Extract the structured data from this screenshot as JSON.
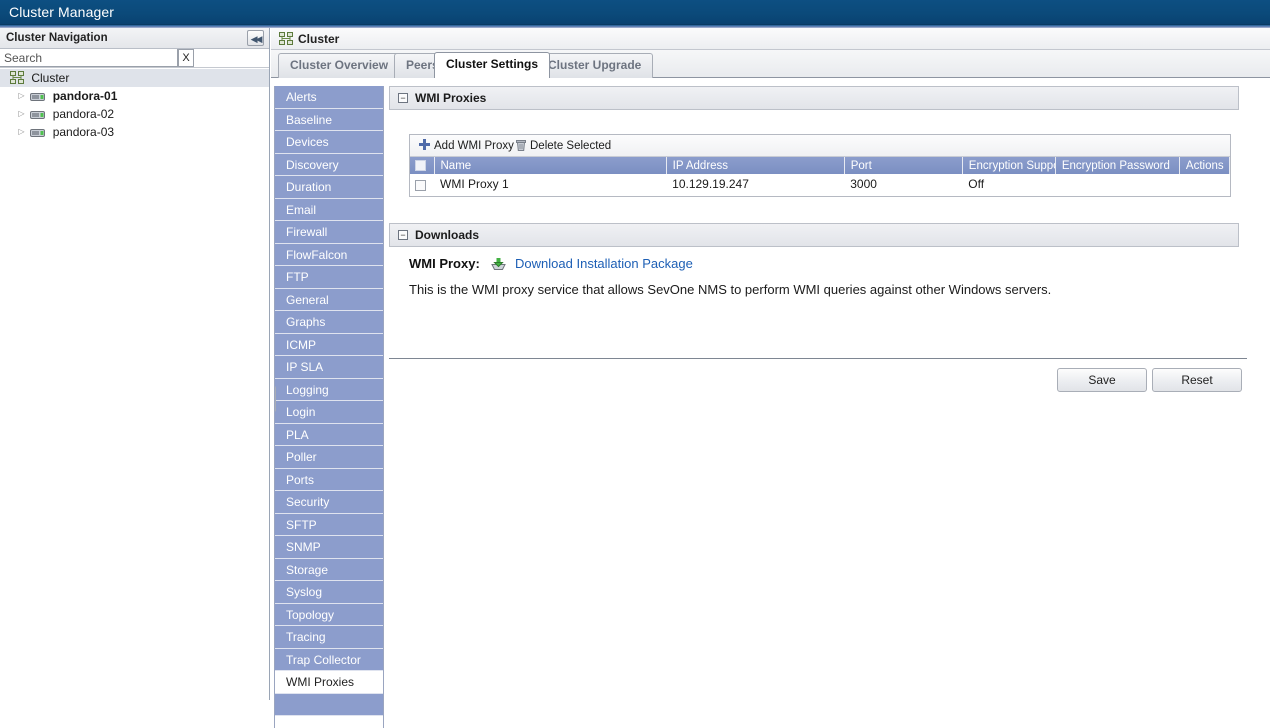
{
  "window": {
    "title": "Cluster Manager"
  },
  "sidebar": {
    "header": "Cluster Navigation",
    "collapse_glyph": "◀◀",
    "search": {
      "placeholder": "Search",
      "value": "",
      "clear_label": "X"
    },
    "tree": [
      {
        "label": "Cluster",
        "icon": "cluster-icon",
        "selected": true,
        "bold": false
      },
      {
        "label": "pandora-01",
        "icon": "server-icon",
        "selected": false,
        "bold": true
      },
      {
        "label": "pandora-02",
        "icon": "server-icon",
        "selected": false,
        "bold": false
      },
      {
        "label": "pandora-03",
        "icon": "server-icon",
        "selected": false,
        "bold": false
      }
    ]
  },
  "breadcrumb": {
    "label": "Cluster",
    "icon": "cluster-icon"
  },
  "tabs": [
    {
      "label": "Cluster Overview",
      "active": false
    },
    {
      "label": "Peers",
      "active": false
    },
    {
      "label": "Cluster Settings",
      "active": true
    },
    {
      "label": "Cluster Upgrade",
      "active": false
    }
  ],
  "settings_menu": {
    "active": "WMI Proxies",
    "items": [
      "Alerts",
      "Baseline",
      "Devices",
      "Discovery",
      "Duration",
      "Email",
      "Firewall",
      "FlowFalcon",
      "FTP",
      "General",
      "Graphs",
      "ICMP",
      "IP SLA",
      "Logging",
      "Login",
      "PLA",
      "Poller",
      "Ports",
      "Security",
      "SFTP",
      "SNMP",
      "Storage",
      "Syslog",
      "Topology",
      "Tracing",
      "Trap Collector",
      "WMI Proxies"
    ]
  },
  "wmi_panel": {
    "title": "WMI Proxies",
    "collapse_glyph": "−",
    "toolbar": {
      "add_label": "Add WMI Proxy",
      "delete_label": "Delete Selected",
      "add_icon": "plus-icon",
      "delete_icon": "trash-icon"
    },
    "table": {
      "columns": [
        "Name",
        "IP Address",
        "Port",
        "Encryption Support",
        "Encryption Password",
        "Actions"
      ],
      "rows": [
        {
          "name": "WMI Proxy 1",
          "ip_address": "10.129.19.247",
          "port": "3000",
          "encryption_support": "Off",
          "encryption_password": "",
          "actions": ""
        }
      ]
    }
  },
  "downloads_panel": {
    "title": "Downloads",
    "collapse_glyph": "−",
    "item_label": "WMI Proxy:",
    "link_label": "Download Installation Package",
    "link_icon": "download-icon",
    "description": "This is the WMI proxy service that allows SevOne NMS to perform WMI queries against other Windows servers."
  },
  "footer": {
    "save_label": "Save",
    "reset_label": "Reset"
  },
  "colors": {
    "titlebar": "#0b4a7a",
    "menu_blue": "#8c9dcc",
    "table_header": "#7f93c4",
    "link": "#1d5fb5",
    "selected_row": "#dfe3ea"
  }
}
